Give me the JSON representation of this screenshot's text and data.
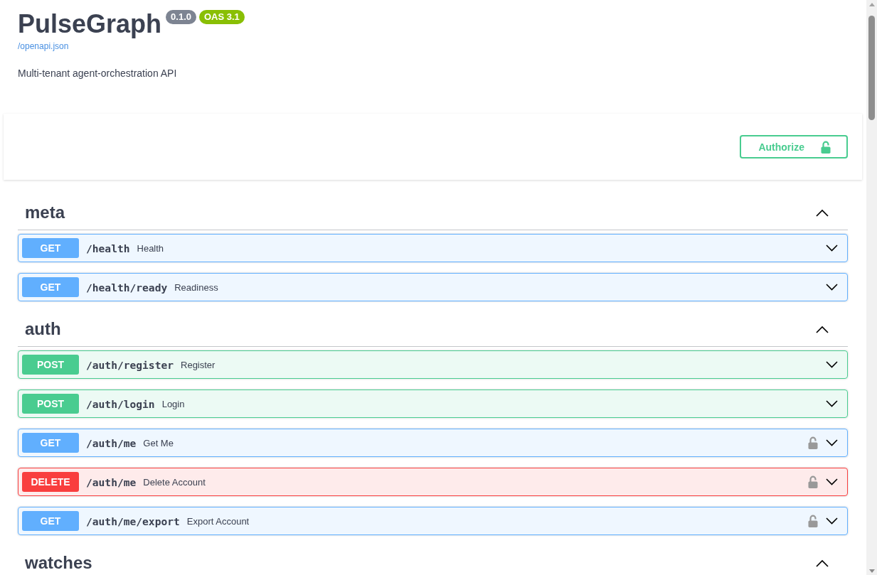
{
  "header": {
    "title": "PulseGraph",
    "version": "0.1.0",
    "spec_version": "OAS 3.1",
    "spec_link": "/openapi.json",
    "description": "Multi-tenant agent-orchestration API"
  },
  "authorize_button": {
    "label": "Authorize"
  },
  "sections": [
    {
      "name": "meta",
      "expanded": true,
      "operations": [
        {
          "method": "GET",
          "color": "#61affe",
          "path": "/health",
          "summary": "Health",
          "secured": false,
          "expanded": false
        },
        {
          "method": "GET",
          "color": "#61affe",
          "path": "/health/ready",
          "summary": "Readiness",
          "secured": false,
          "expanded": false
        }
      ]
    },
    {
      "name": "auth",
      "expanded": true,
      "operations": [
        {
          "method": "POST",
          "color": "#49cc90",
          "path": "/auth/register",
          "summary": "Register",
          "secured": false,
          "expanded": false
        },
        {
          "method": "POST",
          "color": "#49cc90",
          "path": "/auth/login",
          "summary": "Login",
          "secured": false,
          "expanded": false
        },
        {
          "method": "GET",
          "color": "#61affe",
          "path": "/auth/me",
          "summary": "Get Me",
          "secured": true,
          "expanded": false
        },
        {
          "method": "DELETE",
          "color": "#f93e3e",
          "path": "/auth/me",
          "summary": "Delete Account",
          "secured": true,
          "expanded": false
        },
        {
          "method": "GET",
          "color": "#61affe",
          "path": "/auth/me/export",
          "summary": "Export Account",
          "secured": true,
          "expanded": false
        }
      ]
    },
    {
      "name": "watches",
      "expanded": true
    }
  ]
}
